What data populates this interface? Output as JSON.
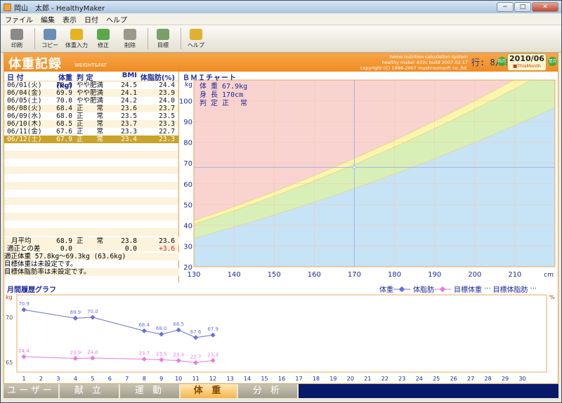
{
  "window": {
    "title": "岡山　太郎 - HealthyMaker",
    "min": "−",
    "max": "□",
    "close": "✕"
  },
  "menu": [
    "ファイル",
    "編集",
    "表示",
    "日付",
    "ヘルプ"
  ],
  "toolbar": [
    {
      "label": "印刷",
      "icon": "printer-icon",
      "color": "#8a8a8a"
    },
    {
      "label": "コピー",
      "icon": "copy-icon",
      "color": "#6a8fb5"
    },
    {
      "label": "体重入力",
      "icon": "weight-input-icon",
      "color": "#e6b422"
    },
    {
      "label": "修正",
      "icon": "edit-icon",
      "color": "#5aa84a"
    },
    {
      "label": "削除",
      "icon": "delete-icon",
      "color": "#9a9a8a"
    },
    {
      "label": "目標",
      "icon": "target-icon",
      "color": "#7aa06a"
    },
    {
      "label": "ヘルプ",
      "icon": "help-icon",
      "color": "#e0b030"
    }
  ],
  "header": {
    "title": "体重記録",
    "subtitle": "WEIGHT&FAT",
    "copyright": [
      "home nutrition calculation system",
      "healthy maker 432c build 2007.02.17",
      "copyright (C) 1998-2007 mushroomsoft co.,ltd."
    ],
    "row_label": "行: 8/ 9",
    "prev": "前月",
    "next": "翌月",
    "month": "2010/06",
    "this_month": "■ThisMonth"
  },
  "table": {
    "headers": [
      "日 付",
      "体重(kg)",
      "判 定",
      "BMI",
      "体脂肪(%)"
    ],
    "rows": [
      [
        "06/01(火)",
        "70.9",
        "やや肥満",
        "24.5",
        "24.4"
      ],
      [
        "06/04(金)",
        "69.9",
        "やや肥満",
        "24.1",
        "23.9"
      ],
      [
        "06/05(土)",
        "70.0",
        "やや肥満",
        "24.2",
        "24.0"
      ],
      [
        "06/08(火)",
        "68.4",
        "正　　常",
        "23.6",
        "23.7"
      ],
      [
        "06/09(水)",
        "68.0",
        "正　　常",
        "23.5",
        "23.5"
      ],
      [
        "06/10(木)",
        "68.5",
        "正　　常",
        "23.7",
        "23.3"
      ],
      [
        "06/11(金)",
        "67.6",
        "正　　常",
        "23.3",
        "22.7"
      ],
      [
        "06/12(土)",
        "67.9",
        "正　　常",
        "23.4",
        "23.3"
      ]
    ],
    "selected_row": 7,
    "empty_rows": 14
  },
  "summary": {
    "avg_label": "月平均",
    "avg_weight": "68.9",
    "avg_judge": "正　　常",
    "avg_bmi": "23.8",
    "avg_fat": "23.6",
    "diff_label": "適正との差",
    "diff_weight": "0.0",
    "diff_bmi": "0.0",
    "diff_fat": "+3.6",
    "proper": "適正体重 57.8kg～69.3kg (63.6kg)",
    "target_weight": "目標体重は未設定です。",
    "target_fat": "目標体脂肪率は未設定です。"
  },
  "bmi_chart": {
    "title": "ＢＭＩチャート",
    "info": [
      "体 重 67.9kg",
      "身 長 170cm",
      "判 定 正　 常"
    ],
    "y_unit": "kg",
    "x_unit": "cm",
    "x_ticks": [
      130,
      140,
      150,
      160,
      170,
      180,
      190,
      200,
      210
    ],
    "y_ticks": [
      20,
      30,
      40,
      50,
      60,
      70,
      80,
      90,
      100
    ],
    "x_range": [
      130,
      220
    ],
    "y_range": [
      20,
      110
    ],
    "marker": {
      "height": 170,
      "weight": 67.9
    },
    "zone_colors": {
      "obese": "#f9d3d0",
      "over": "#fbf6ad",
      "normal": "#d8f0b8",
      "under": "#c7e3f6"
    }
  },
  "history": {
    "title": "月間履歴グラフ",
    "legend": {
      "weight": "体重",
      "fat": "体脂肪",
      "target_weight": "目標体重",
      "target_fat": "目標体脂肪"
    },
    "y_left_unit": "kg",
    "y_right_unit": "%",
    "y_left_ticks": [
      "70",
      "65"
    ],
    "days": [
      1,
      2,
      3,
      4,
      5,
      6,
      7,
      8,
      9,
      10,
      11,
      12,
      13,
      14,
      15,
      16,
      17,
      18,
      19,
      20,
      21,
      22,
      23,
      24,
      25,
      26,
      27,
      28,
      29,
      30
    ],
    "weight_color": "#6a6fd8",
    "fat_color": "#e878e0"
  },
  "chart_data": {
    "type": "line",
    "title": "月間履歴グラフ",
    "x": [
      1,
      4,
      5,
      8,
      9,
      10,
      11,
      12
    ],
    "series": [
      {
        "name": "体重",
        "values": [
          70.9,
          69.9,
          70.0,
          68.4,
          68.0,
          68.5,
          67.6,
          67.9
        ]
      },
      {
        "name": "体脂肪",
        "values": [
          24.4,
          23.9,
          24.0,
          23.7,
          23.5,
          23.3,
          22.7,
          23.3
        ]
      }
    ],
    "xlim": [
      1,
      31
    ]
  },
  "tabs": [
    "ユーザー",
    "献 立",
    "運 動",
    "体 重",
    "分 析"
  ],
  "active_tab": 3
}
